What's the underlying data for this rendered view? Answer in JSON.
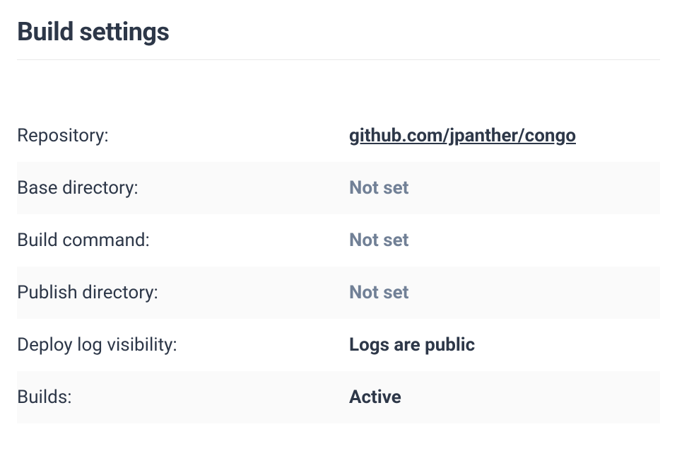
{
  "title": "Build settings",
  "rows": [
    {
      "label": "Repository:",
      "value": "github.com/jpanther/congo",
      "is_link": true,
      "is_notset": false
    },
    {
      "label": "Base directory:",
      "value": "Not set",
      "is_link": false,
      "is_notset": true
    },
    {
      "label": "Build command:",
      "value": "Not set",
      "is_link": false,
      "is_notset": true
    },
    {
      "label": "Publish directory:",
      "value": "Not set",
      "is_link": false,
      "is_notset": true
    },
    {
      "label": "Deploy log visibility:",
      "value": "Logs are public",
      "is_link": false,
      "is_notset": false
    },
    {
      "label": "Builds:",
      "value": "Active",
      "is_link": false,
      "is_notset": false
    }
  ]
}
